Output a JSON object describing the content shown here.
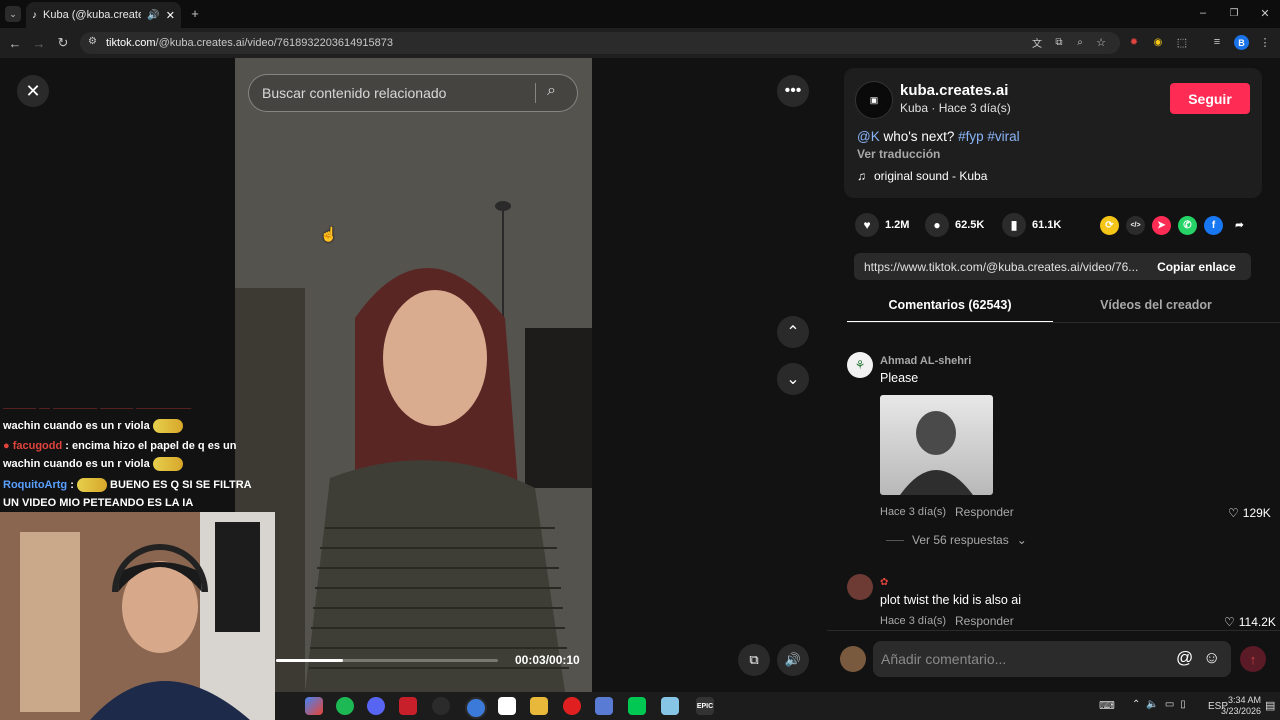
{
  "browser": {
    "tab_title": "Kuba (@kuba.creates.ai) | T",
    "url_host": "tiktok.com",
    "url_path": "/@kuba.creates.ai/video/7618932203614915873",
    "profile_initial": "B"
  },
  "video": {
    "search_placeholder": "Buscar contenido relacionado",
    "time": "00:03/00:10",
    "progress": 0.3
  },
  "author": {
    "username": "kuba.creates.ai",
    "subtitle": "Kuba · Hace 3 día(s)",
    "follow_label": "Seguir",
    "caption_mention": "@K",
    "caption_text": " who's next? ",
    "caption_tags": "#fyp #viral",
    "translate_label": "Ver traducción",
    "sound": "original sound - Kuba"
  },
  "stats": {
    "likes": "1.2M",
    "comments": "62.5K",
    "saves": "61.1K"
  },
  "share": {
    "url": "https://www.tiktok.com/@kuba.creates.ai/video/76...",
    "copy_label": "Copiar enlace",
    "icons": [
      "repost-icon",
      "embed-icon",
      "send-icon",
      "whatsapp-icon",
      "facebook-icon",
      "share-arrow-icon"
    ],
    "colors": [
      "#f5c518",
      "#2b2b2b",
      "#fe2c55",
      "#25d366",
      "#1877f2",
      "#121212"
    ]
  },
  "tabs": {
    "comments": "Comentarios (62543)",
    "creator_videos": "Vídeos del creador"
  },
  "comments": [
    {
      "name": "Ahmad AL-shehri",
      "text": "Please",
      "time": "Hace 3 día(s)",
      "reply": "Responder",
      "likes": "129K",
      "replies_label": "Ver 56 respuestas"
    },
    {
      "name": "",
      "text": "plot twist the kid is also ai",
      "time": "Hace 3 día(s)",
      "reply": "Responder",
      "likes": "114.2K"
    }
  ],
  "compose": {
    "placeholder": "Añadir comentario..."
  },
  "chat": [
    {
      "user": "facugodd",
      "user_color": "#e0443d",
      "text": " : encima hizo el papel de q es un wachin cuando es un r viola"
    },
    {
      "user": "RoquitoArtg",
      "user_color": "#5aa0ff",
      "text": " BUENO ES Q SI SE FILTRA UN VIDEO MIO PETEANDO ES LA IA"
    }
  ],
  "chat_top_partial": "wachin cuando es un r viola",
  "taskbar": {
    "lang": "ESP",
    "time": "3:34 AM",
    "date": "3/23/2026"
  }
}
